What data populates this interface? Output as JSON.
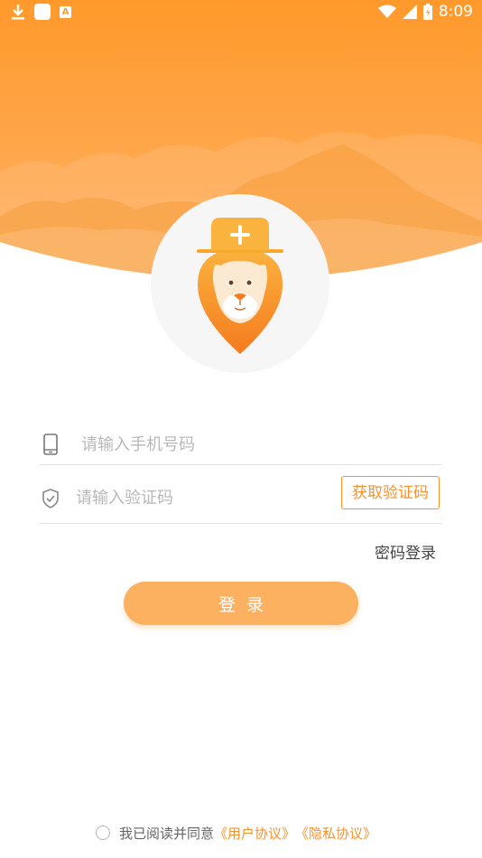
{
  "status_bar": {
    "time": "8:09"
  },
  "form": {
    "phone_placeholder": "请输入手机号码",
    "code_placeholder": "请输入验证码",
    "get_code_label": "获取验证码",
    "password_login_label": "密码登录",
    "login_label": "登录"
  },
  "agreement": {
    "text": "我已阅读并同意",
    "user_agreement": "《用户协议》",
    "privacy_agreement": "《隐私协议》"
  },
  "colors": {
    "accent": "#f7922b",
    "header_top": "#ff9a2c",
    "button": "#fbb15f"
  },
  "icons": [
    "download-icon",
    "app-icon",
    "font-icon",
    "wifi-icon",
    "signal-icon",
    "battery-icon",
    "phone-icon",
    "shield-icon",
    "lion-doctor-logo"
  ]
}
